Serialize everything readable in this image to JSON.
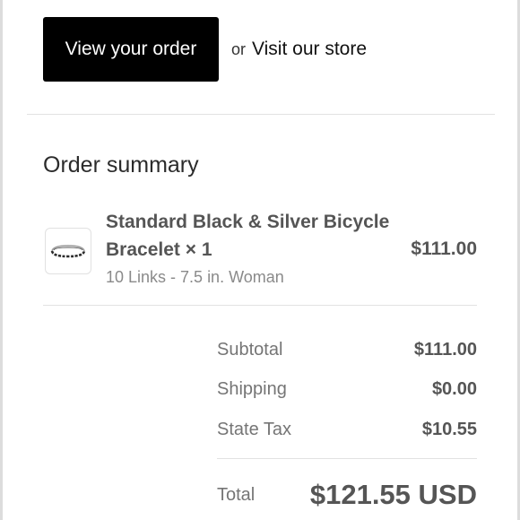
{
  "actions": {
    "view_order_label": "View your order",
    "or_text": "or",
    "visit_store_label": "Visit our store"
  },
  "summary": {
    "heading": "Order summary",
    "items": [
      {
        "title_line1": "Standard Black & Silver Bicycle",
        "title_line2": "Bracelet × 1",
        "variant": "10 Links - 7.5 in. Woman",
        "price": "$111.00",
        "thumbnail_icon": "bracelet-thumbnail"
      }
    ],
    "rows": [
      {
        "label": "Subtotal",
        "value": "$111.00"
      },
      {
        "label": "Shipping",
        "value": "$0.00"
      },
      {
        "label": "State Tax",
        "value": "$10.55"
      }
    ],
    "total": {
      "label": "Total",
      "amount": "$121.55",
      "currency": "USD"
    }
  },
  "colors": {
    "button_bg": "#000000",
    "button_text": "#ffffff",
    "text_primary": "#555555",
    "text_muted": "#8a8a8a",
    "divider": "#e2e2e2"
  }
}
